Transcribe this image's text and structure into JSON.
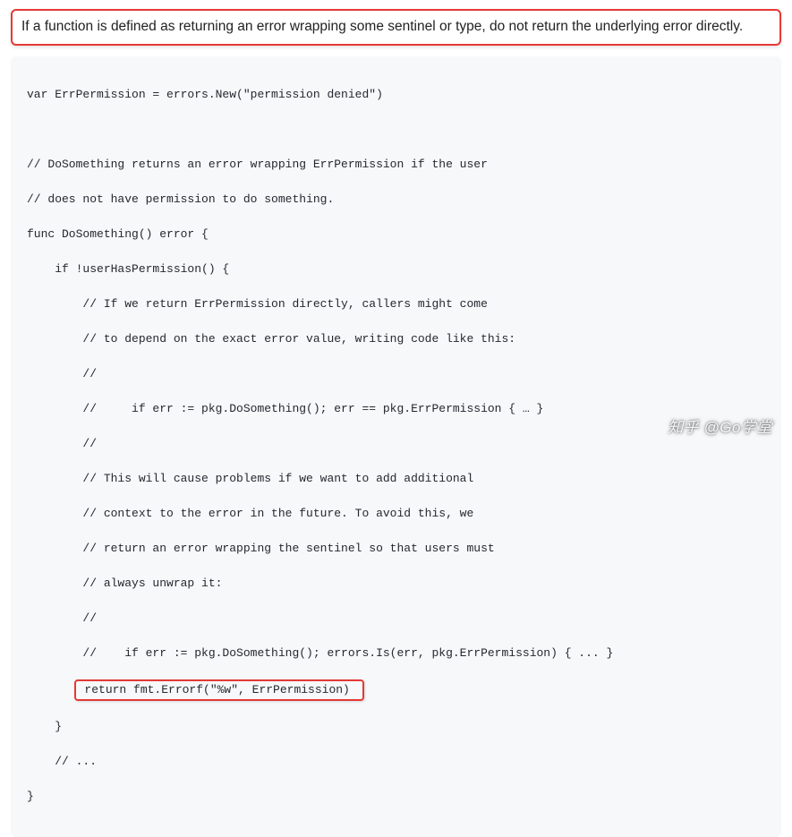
{
  "callout": {
    "text": "If a function is defined as returning an error wrapping some sentinel or type, do not return the underlying error directly."
  },
  "code": {
    "lines": [
      "var ErrPermission = errors.New(\"permission denied\")",
      "",
      "// DoSomething returns an error wrapping ErrPermission if the user",
      "// does not have permission to do something.",
      "func DoSomething() error {",
      "    if !userHasPermission() {",
      "        // If we return ErrPermission directly, callers might come",
      "        // to depend on the exact error value, writing code like this:",
      "        //",
      "        //     if err := pkg.DoSomething(); err == pkg.ErrPermission { … }",
      "        //",
      "        // This will cause problems if we want to add additional",
      "        // context to the error in the future. To avoid this, we",
      "        // return an error wrapping the sentinel so that users must",
      "        // always unwrap it:",
      "        //",
      "        //    if err := pkg.DoSomething(); errors.Is(err, pkg.ErrPermission) { ... }",
      "        return fmt.Errorf(\"%w\", ErrPermission)",
      "    }",
      "    // ...",
      "}"
    ],
    "highlight_indent": "       ",
    "highlight_content": " return fmt.Errorf(\"%w\", ErrPermission) "
  },
  "watermark": {
    "text": "知乎 @Go学堂"
  }
}
